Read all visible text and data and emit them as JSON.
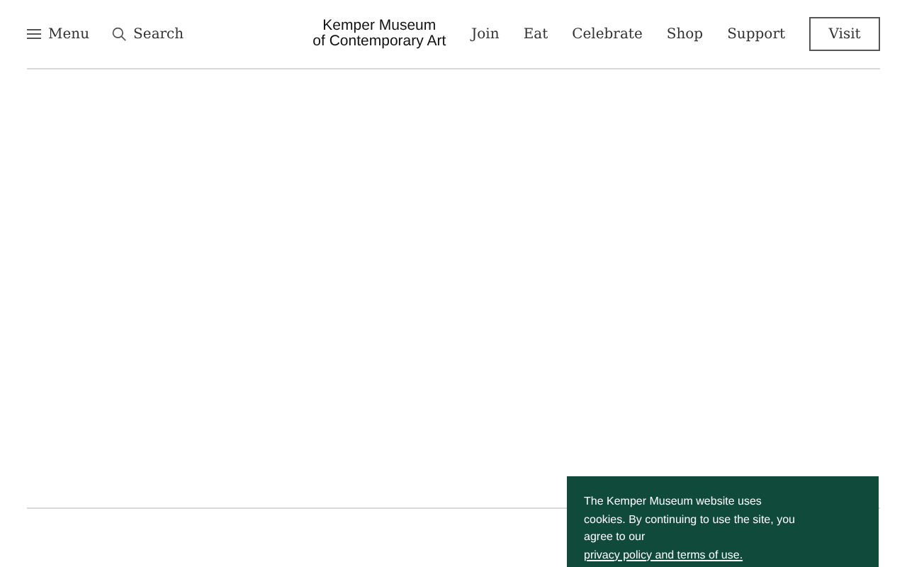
{
  "header": {
    "menu": "Menu",
    "search": "Search",
    "logo": [
      "Kemper Museum",
      "of Contemporary Art"
    ],
    "nav": [
      "Join",
      "Eat",
      "Celebrate",
      "Shop",
      "Support"
    ],
    "visit": "Visit"
  },
  "cookie_banner": {
    "text": "The Kemper Museum website uses cookies. By continuing to use the site, you agree to our",
    "link": "privacy policy and terms of use."
  }
}
